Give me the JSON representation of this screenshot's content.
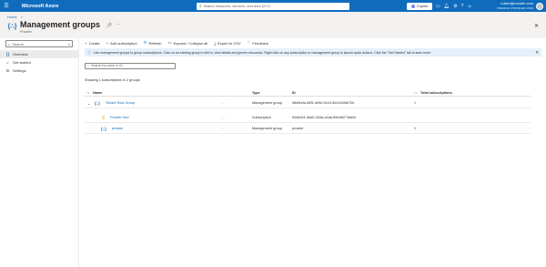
{
  "topbar": {
    "menu_icon": "hamburger-icon",
    "brand": "Microsoft Azure",
    "search_placeholder": "Search resources, services, and docs (G+/)",
    "copilot_label": "Copilot",
    "icons": [
      "cloud-shell-icon",
      "notifications-icon",
      "settings-icon",
      "help-icon",
      "feedback-icon"
    ],
    "user_name": "ruben@prowler.com",
    "user_tenant": "PREMIUM (PROWLER.COM)"
  },
  "breadcrumb": {
    "home": "Home",
    "sep": ">"
  },
  "header": {
    "title": "Management groups",
    "subtitle": "Prowler"
  },
  "sidebar": {
    "search_placeholder": "Search",
    "items": [
      {
        "label": "Overview",
        "icon": "overview-icon",
        "active": true
      },
      {
        "label": "Get started",
        "icon": "rocket-icon",
        "active": false
      },
      {
        "label": "Settings",
        "icon": "gear-icon",
        "active": false
      }
    ]
  },
  "toolbar": {
    "create": "Create",
    "add_subscription": "Add subscription",
    "refresh": "Refresh",
    "expand": "Expand / Collapse all",
    "export": "Export to CSV",
    "feedback": "Feedback"
  },
  "info": "Use management groups to group subscriptions. Click on an existing group to drill in, view details and govern resources. Right click on any subscription or management group to launch quick actions. Click the \"Get Started\" tab to learn more",
  "filter_placeholder": "Search by name or ID",
  "summary": "Showing 1 subscriptions in 2 groups",
  "table": {
    "headers": {
      "name": "Name",
      "type": "Type",
      "id": "ID",
      "total": "Total subscriptions"
    },
    "rows": [
      {
        "name": "Tenant Root Group",
        "type": "Management group",
        "id": "96df4efa-083f-4e9e-91e0-5d1e04f4b72b",
        "total": "1",
        "more": "..."
      },
      {
        "name": "Prowler Dev",
        "type": "Subscription",
        "id": "b0d6441-5dd0-434a-a2da-89ed6271bd0e",
        "total": "",
        "more": "..."
      },
      {
        "name": "prowler",
        "type": "Management group",
        "id": "prowler",
        "total": "0",
        "more": "..."
      }
    ]
  },
  "colors": {
    "azure_blue": "#0f6cbd",
    "info_bg": "#e5f0fb",
    "key_gold": "#f2b10a"
  }
}
